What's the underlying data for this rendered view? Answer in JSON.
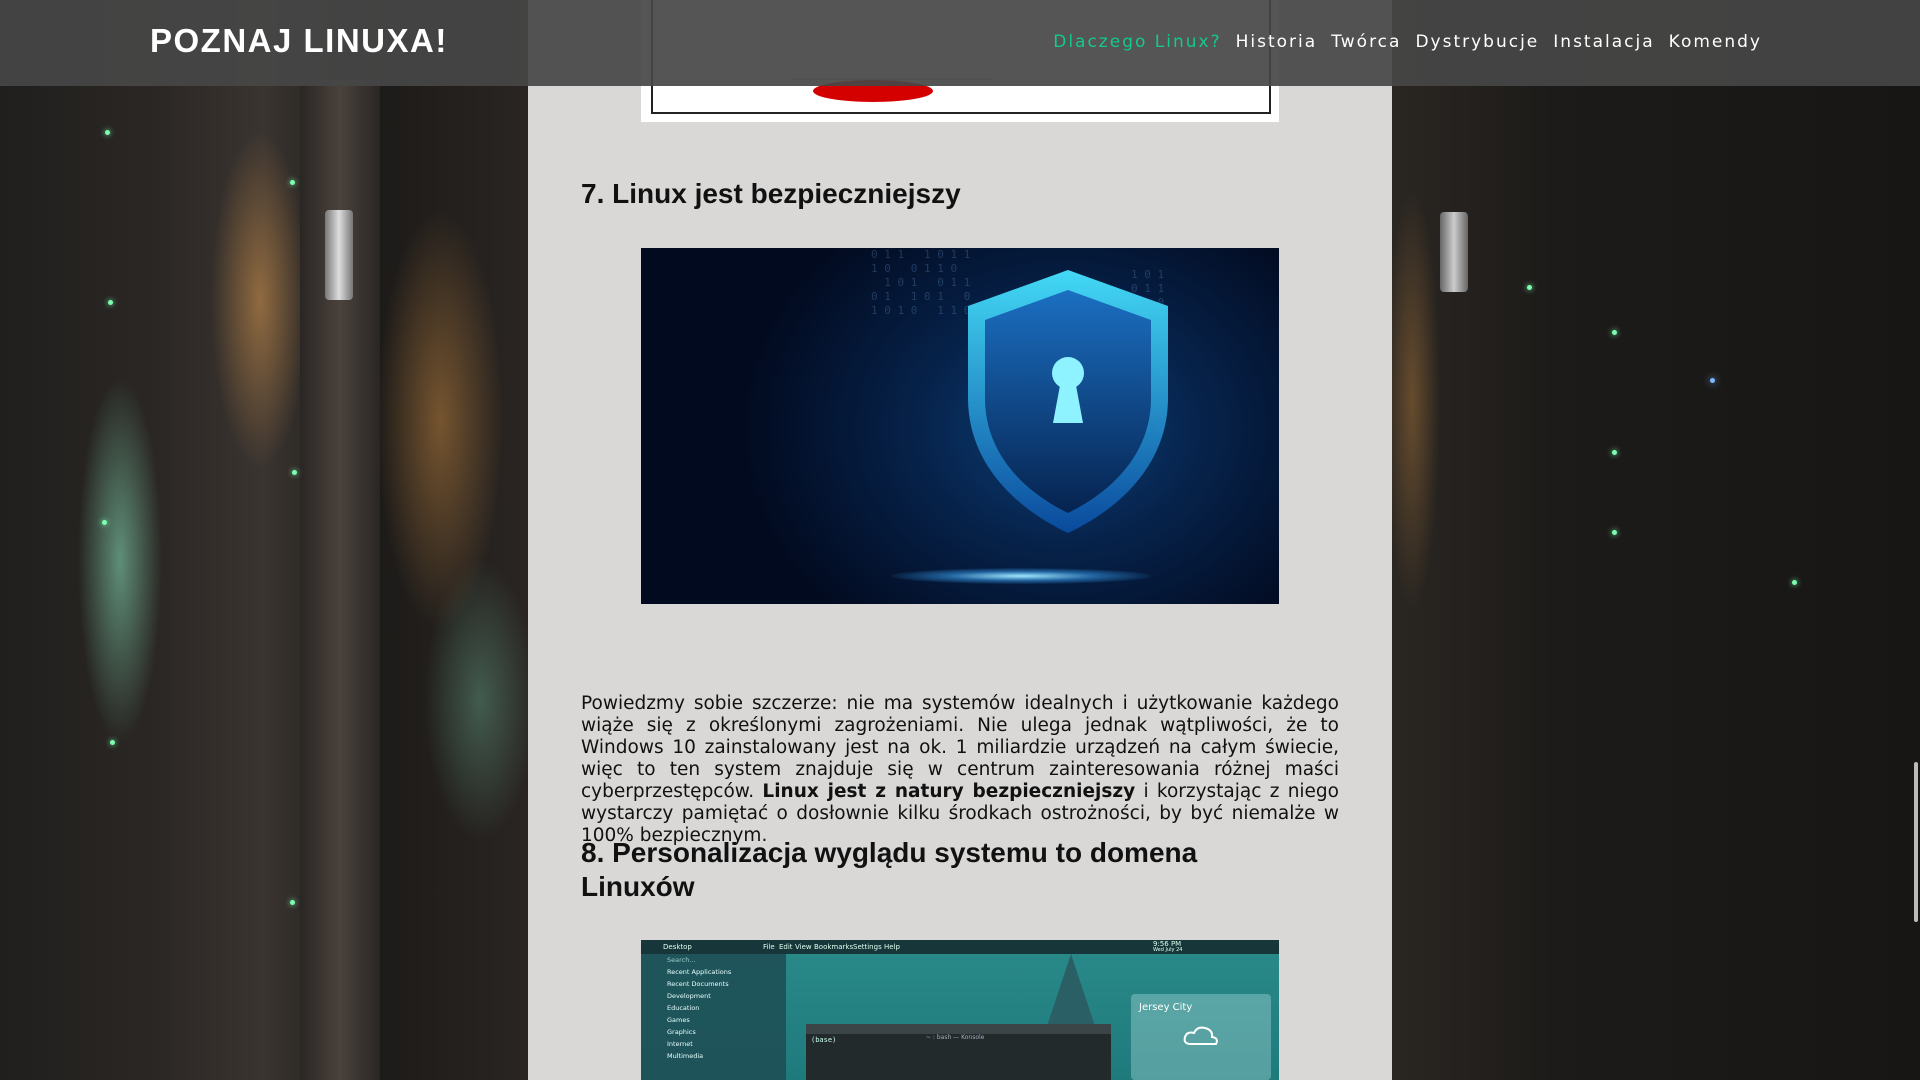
{
  "header": {
    "brand": "POZNAJ LINUXA!",
    "nav": [
      {
        "label": "Dlaczego Linux?",
        "active": true
      },
      {
        "label": "Historia",
        "active": false
      },
      {
        "label": "Twórca",
        "active": false
      },
      {
        "label": "Dystrybucje",
        "active": false
      },
      {
        "label": "Instalacja",
        "active": false
      },
      {
        "label": "Komendy",
        "active": false
      }
    ],
    "accent_color": "#14c98a"
  },
  "content": {
    "section7": {
      "heading": "7. Linux jest bezpieczniejszy",
      "paragraph_part1": "Powiedzmy sobie szczerze: nie ma systemów idealnych i użytkowanie każdego wiąże się z określonymi zagrożeniami. Nie ulega jednak wątpliwości, że to Windows 10 zainstalowany jest na ok. 1 miliardzie urządzeń na całym świecie, więc to ten system znajduje się w centrum zainteresowania różnej maści cyberprzestępców. ",
      "paragraph_bold": "Linux jest z natury bezpieczniejszy",
      "paragraph_part2": " i korzystając z niego wystarczy pamiętać o dosłownie kilku środkach ostrożności, by być niemalże w 100% bezpiecznym."
    },
    "section8": {
      "heading": "8. Personalizacja wyglądu systemu to domena Linuxów"
    },
    "kde_screenshot": {
      "topbar_app": "Desktop",
      "topbar_menu": [
        "File",
        "Edit",
        "View",
        "Bookmarks",
        "Settings",
        "Help"
      ],
      "clock": "9:56 PM",
      "date": "Wed July 24",
      "menu_items": [
        "Recent Applications",
        "Recent Documents",
        "Development",
        "Education",
        "Games",
        "Graphics",
        "Internet",
        "Multimedia"
      ],
      "search_placeholder": "Search...",
      "terminal_title": "~ : bash — Konsole",
      "terminal_prompt": "(base) ",
      "weather_city": "Jersey City"
    }
  }
}
